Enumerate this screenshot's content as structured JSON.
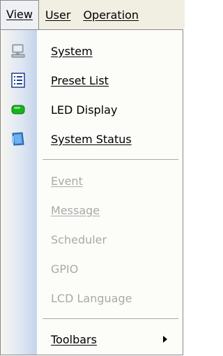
{
  "menubar": {
    "items": [
      {
        "label": "View"
      },
      {
        "label": "User"
      },
      {
        "label": "Operation"
      }
    ]
  },
  "view_menu": {
    "items": [
      {
        "label": "System",
        "enabled": true,
        "icon": "computer-icon"
      },
      {
        "label": "Preset List",
        "enabled": true,
        "icon": "list-icon"
      },
      {
        "label": "LED Display",
        "enabled": true,
        "icon": "led-icon"
      },
      {
        "label": "System Status",
        "enabled": true,
        "icon": "status-icon"
      },
      {
        "label": "Event",
        "enabled": false
      },
      {
        "label": "Message",
        "enabled": false
      },
      {
        "label": "Scheduler",
        "enabled": false
      },
      {
        "label": "GPIO",
        "enabled": false
      },
      {
        "label": "LCD Language",
        "enabled": false
      },
      {
        "label": "Toolbars",
        "enabled": true,
        "submenu": true
      }
    ]
  }
}
